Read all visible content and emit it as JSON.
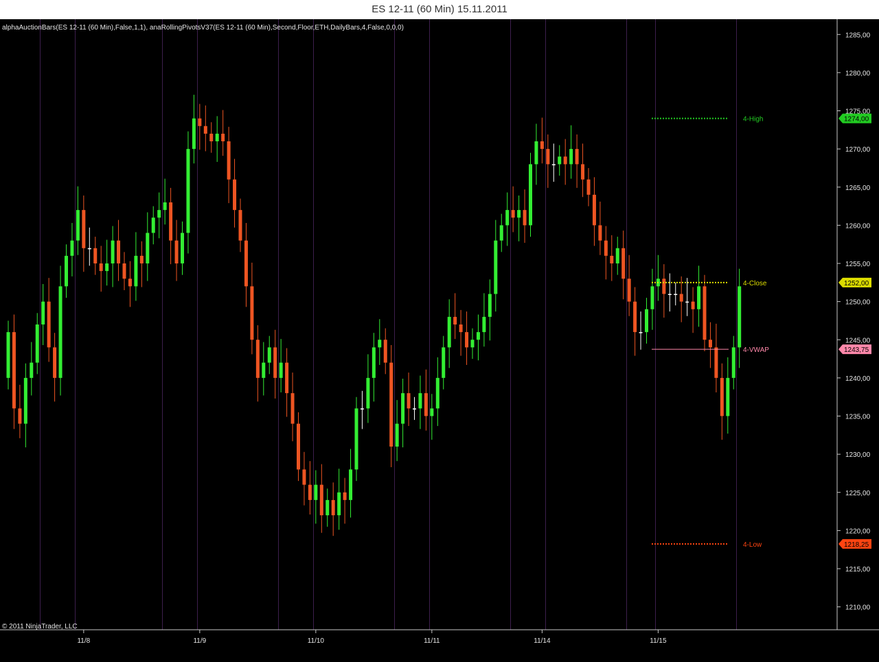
{
  "window": {
    "title": "ES 12-11 (60 Min)  15.11.2011"
  },
  "indicator_label": "alphaAuctionBars(ES 12-11 (60 Min),False,1,1), anaRollingPivotsV37(ES 12-11 (60 Min),Second,Floor,ETH,DailyBars,4,False,0,0,0)",
  "copyright": "© 2011 NinjaTrader, LLC",
  "colors": {
    "background": "#000000",
    "up": "#33ee33",
    "down": "#ee5522",
    "doji": "#ffffff",
    "session_line": "#3d1f4d",
    "axis_text": "#e6e6e6",
    "pivot_high": "#22cc22",
    "pivot_close": "#dddd00",
    "pivot_vwap": "#ff88aa",
    "pivot_low": "#ff4411"
  },
  "chart_data": {
    "type": "candlestick",
    "symbol": "ES 12-11",
    "interval": "60 Min",
    "ylim": [
      1207.0,
      1287.0
    ],
    "y_ticks": [
      "1210,00",
      "1215,00",
      "1220,00",
      "1225,00",
      "1230,00",
      "1235,00",
      "1240,00",
      "1245,00",
      "1250,00",
      "1255,00",
      "1260,00",
      "1265,00",
      "1270,00",
      "1275,00",
      "1280,00",
      "1285,00"
    ],
    "y_tick_values": [
      1210,
      1215,
      1220,
      1225,
      1230,
      1235,
      1240,
      1245,
      1250,
      1255,
      1260,
      1265,
      1270,
      1275,
      1280,
      1285
    ],
    "x_ticks": [
      {
        "label": "11/8",
        "bar": 13
      },
      {
        "label": "11/9",
        "bar": 33
      },
      {
        "label": "11/10",
        "bar": 53
      },
      {
        "label": "11/11",
        "bar": 73
      },
      {
        "label": "11/14",
        "bar": 92
      },
      {
        "label": "11/15",
        "bar": 112
      }
    ],
    "session_separators": [
      6,
      12,
      27,
      33,
      47,
      53,
      67,
      73,
      87,
      93,
      107,
      112,
      126
    ],
    "pivots": [
      {
        "name": "4-High",
        "value": 1274.0,
        "label": "1274,00",
        "style": "dotted",
        "color": "#22cc22"
      },
      {
        "name": "4-Close",
        "value": 1252.5,
        "label": "1252,00",
        "style": "dotted",
        "color": "#dddd00"
      },
      {
        "name": "4-VWAP",
        "value": 1243.75,
        "label": "1243,75",
        "style": "solid",
        "color": "#ff88aa"
      },
      {
        "name": "4-Low",
        "value": 1218.25,
        "label": "1218,25",
        "style": "dotted",
        "color": "#ff4411"
      }
    ],
    "pivot_start_bar": 112,
    "pivot_end_bar": 126,
    "last_price_label": "1252,00",
    "closes": [
      1246,
      1236,
      1234,
      1240,
      1242,
      1247,
      1250,
      1244,
      1240,
      1252,
      1256,
      1258,
      1262,
      1257,
      1257,
      1255,
      1254,
      1255,
      1258,
      1255,
      1253,
      1252,
      1256,
      1255,
      1259,
      1261,
      1262,
      1263,
      1258,
      1255,
      1259,
      1270,
      1274,
      1273,
      1272,
      1271,
      1272,
      1271,
      1266,
      1262,
      1258,
      1252,
      1245,
      1240,
      1242,
      1244,
      1240,
      1242,
      1238,
      1234,
      1228,
      1226,
      1224,
      1226,
      1222,
      1224,
      1222,
      1225,
      1224,
      1228,
      1236,
      1236,
      1240,
      1244,
      1245,
      1242,
      1231,
      1234,
      1238,
      1236,
      1236,
      1238,
      1235,
      1236,
      1240,
      1244,
      1248,
      1247,
      1246,
      1244,
      1245,
      1246,
      1248,
      1251,
      1258,
      1260,
      1262,
      1261,
      1262,
      1260,
      1268,
      1271,
      1270,
      1268,
      1268,
      1269,
      1268,
      1270,
      1268,
      1266,
      1264,
      1260,
      1258,
      1256,
      1255,
      1257,
      1253,
      1250,
      1246,
      1246,
      1249,
      1252,
      1253,
      1251,
      1251,
      1251,
      1250,
      1250,
      1249,
      1252,
      1245,
      1244,
      1240,
      1235,
      1240,
      1244,
      1252
    ]
  }
}
